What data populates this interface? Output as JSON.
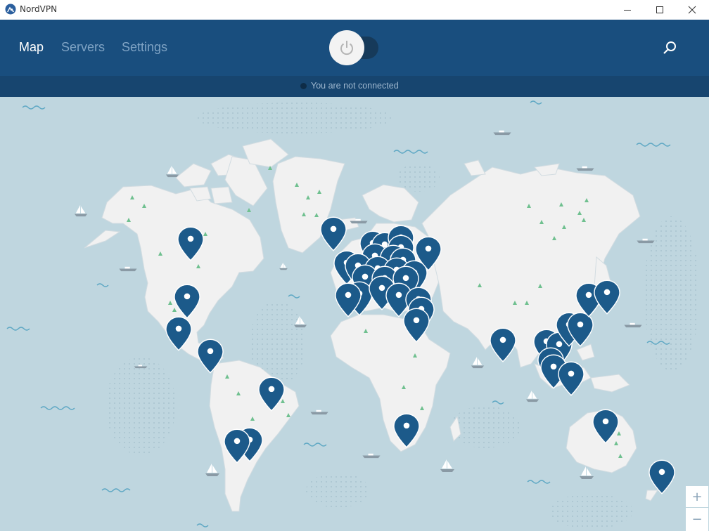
{
  "window": {
    "title": "NordVPN"
  },
  "nav": {
    "tabs": [
      {
        "label": "Map"
      },
      {
        "label": "Servers"
      },
      {
        "label": "Settings"
      }
    ]
  },
  "status": {
    "text": "You are not connected"
  },
  "zoom": {
    "in_label": "+",
    "out_label": "−"
  },
  "colors": {
    "header": "#194e7e",
    "status_bar": "#17456f",
    "ocean": "#bfd6df",
    "land": "#f1f1f1",
    "pin": "#1c5a8a",
    "tree": "#6fc08f"
  }
}
